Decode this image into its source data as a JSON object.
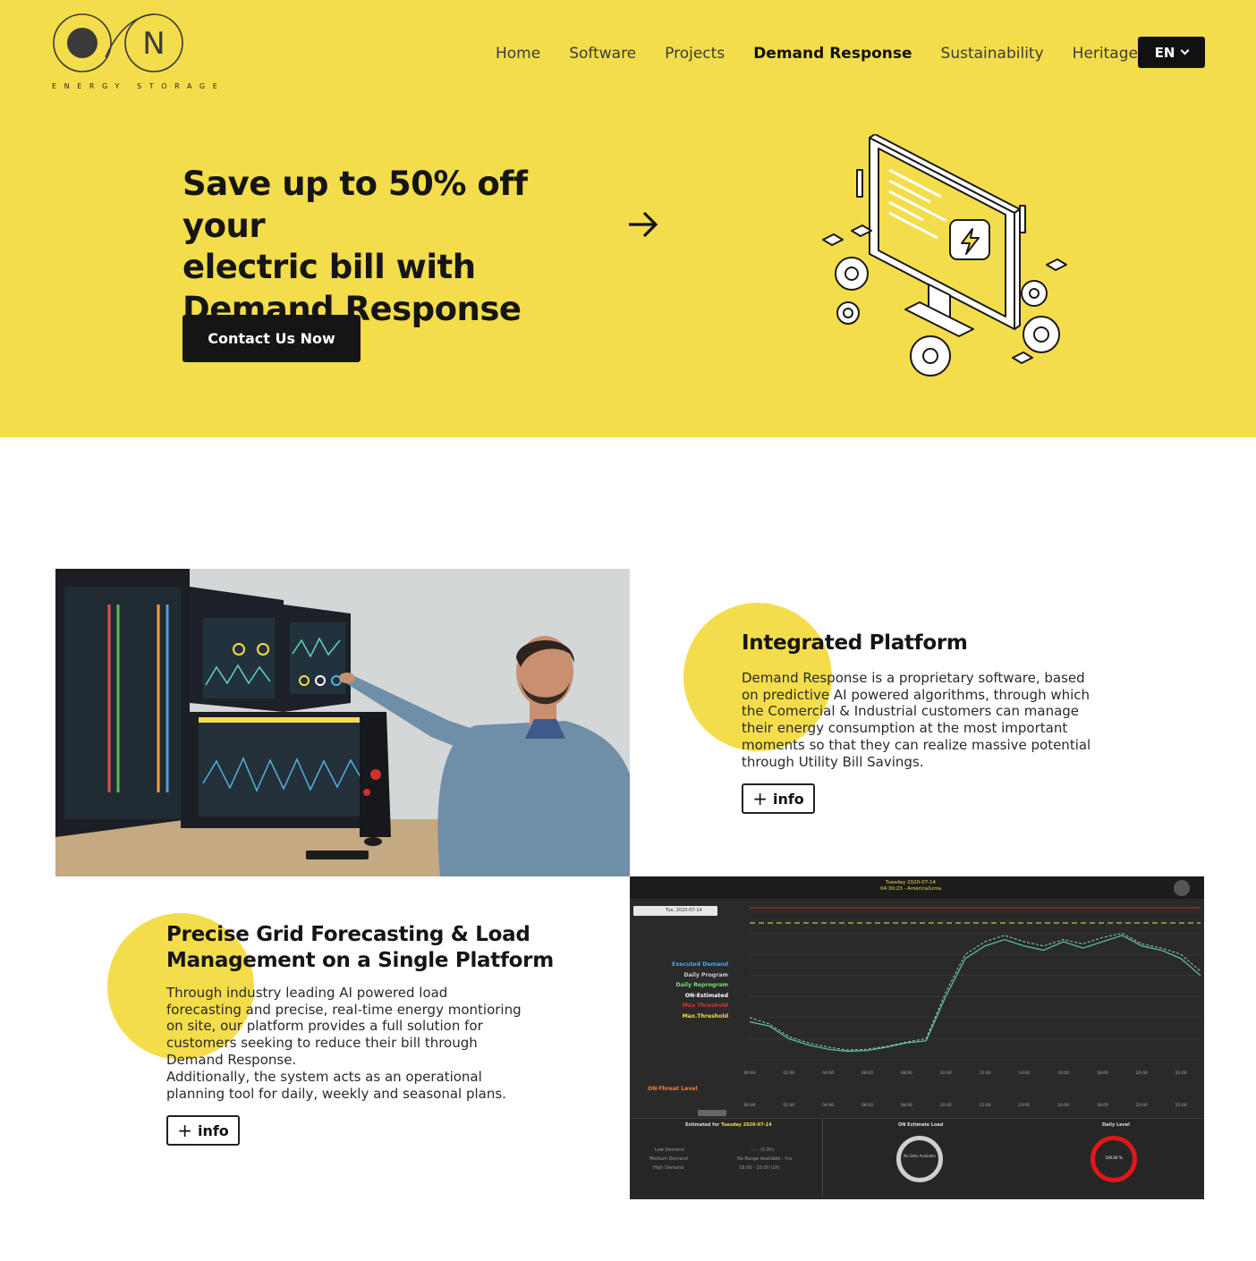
{
  "brand": {
    "logo_letter": "N",
    "tagline": "ENERGY STORAGE",
    "colors": {
      "yellow": "#f4dd4b",
      "dark": "#151515",
      "chart_line": "#5fb8a0"
    }
  },
  "nav": {
    "items": [
      {
        "label": "Home"
      },
      {
        "label": "Software"
      },
      {
        "label": "Projects"
      },
      {
        "label": "Demand Response",
        "active": true
      },
      {
        "label": "Sustainability"
      },
      {
        "label": "Heritage"
      }
    ],
    "language": "EN"
  },
  "hero": {
    "title_line1": "Save up to 50% off your",
    "title_line2": "electric bill with",
    "title_line3": "Demand Response",
    "cta_label": "Contact Us Now"
  },
  "integrated": {
    "title": "Integrated Platform",
    "body": "Demand Response is a proprietary software, based on predictive  AI powered algorithms, through which the Comercial & Industrial customers can manage their energy consumption at the most important moments so that they can realize massive potential through Utility Bill Savings.",
    "info_label": "info"
  },
  "forecasting": {
    "title_line1": "Precise Grid Forecasting & Load",
    "title_line2": "Management on a Single Platform",
    "body1": "Through industry leading AI powered load forecasting and precise, real-time energy montioring on site, our platform provides a full solution for customers seeking to reduce their bill through Demand Response.",
    "body2": "Additionally, the system acts as an operational planning tool for daily, weekly and seasonal plans.",
    "info_label": "info"
  },
  "dashboard": {
    "date_line1": "Tuesday 2020-07-14",
    "date_line2": "04:30:23 - America/Lima",
    "date_select": "Tue, 2020-07-14",
    "legend": [
      {
        "label": "Executed Demand",
        "color": "#3fa9f5"
      },
      {
        "label": "Daily Program",
        "color": "#cccccc"
      },
      {
        "label": "Daily Reprogram",
        "color": "#7ddc7d"
      },
      {
        "label": "ON-Estimated",
        "color": "#ffffff"
      },
      {
        "label": "Max Threshold",
        "color": "#e03030"
      },
      {
        "label": "Max.Threshold",
        "color": "#f4dd4b"
      }
    ],
    "threat_label": "ON-Threat Level",
    "estimated_for": "Estimated for",
    "estimated_date": "Tuesday 2020-07-14",
    "estimate_load_title": "ON Estimate Load",
    "daily_level_title": "Daily Level",
    "gauge_left_text": "No Data Available",
    "gauge_right_text": "100.00 %",
    "rows": [
      "Low Demand",
      "Medium Demand",
      "High Demand"
    ],
    "row_values": [
      "- - - (0.0h)",
      "No Range Available : hrs",
      "18:00 - 20:00 (2h)"
    ],
    "chart_data": {
      "type": "line",
      "x": [
        "00:00",
        "01:00",
        "02:00",
        "03:00",
        "04:00",
        "05:00",
        "06:00",
        "07:00",
        "08:00",
        "09:00",
        "10:00",
        "11:00",
        "12:00",
        "13:00",
        "14:00",
        "15:00",
        "16:00",
        "17:00",
        "18:00",
        "19:00",
        "20:00",
        "21:00",
        "22:00",
        "23:00"
      ],
      "series": [
        {
          "name": "Executed Demand",
          "values": [
            1900,
            1800,
            1500,
            1350,
            1250,
            1200,
            1220,
            1300,
            1400,
            1450,
            2500,
            3400,
            3700,
            3850,
            3700,
            3600,
            3800,
            3650,
            3800,
            3950,
            3700,
            3600,
            3400,
            3000
          ]
        },
        {
          "name": "ON-Estimated",
          "values": [
            2000,
            1850,
            1550,
            1400,
            1300,
            1230,
            1250,
            1320,
            1420,
            1500,
            2600,
            3500,
            3800,
            3950,
            3800,
            3700,
            3850,
            3750,
            3900,
            4000,
            3750,
            3650,
            3500,
            3100
          ]
        }
      ],
      "ylim": [
        1000,
        4500
      ]
    }
  }
}
